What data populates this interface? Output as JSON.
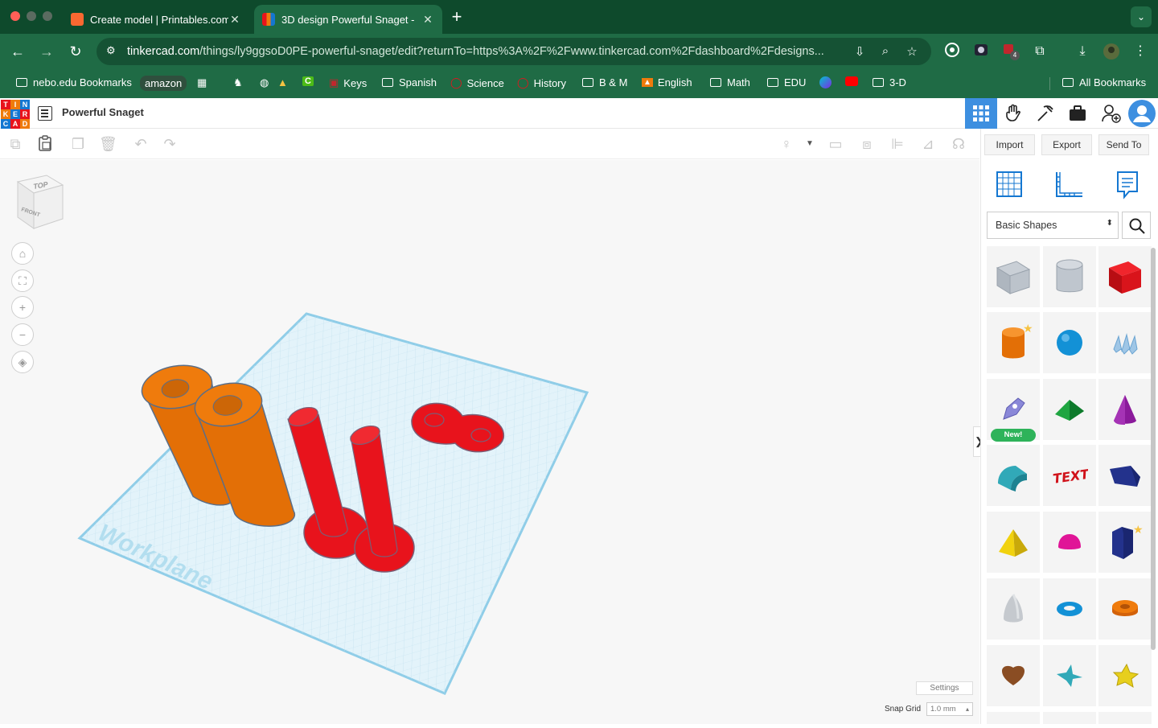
{
  "browser": {
    "tabs": [
      {
        "title": "Create model | Printables.com",
        "active": false
      },
      {
        "title": "3D design Powerful Snaget -",
        "active": true
      }
    ],
    "url_host": "tinkercad.com",
    "url_path": "/things/ly9ggsoD0PE-powerful-snaget/edit?returnTo=https%3A%2F%2Fwww.tinkercad.com%2Fdashboard%2Fdesigns...",
    "extension_badge": "4"
  },
  "bookmarks": [
    "nebo.edu Bookmarks",
    "amazon",
    "Keys",
    "Spanish",
    "Science",
    "History",
    "B & M",
    "English",
    "Math",
    "EDU",
    "3-D",
    "All Bookmarks"
  ],
  "app": {
    "logo_letters": [
      "T",
      "I",
      "N",
      "K",
      "E",
      "R",
      "C",
      "A",
      "D"
    ],
    "design_name": "Powerful Snaget",
    "import_label": "Import",
    "export_label": "Export",
    "send_label": "Send To",
    "shape_library": "Basic Shapes",
    "new_badge": "New!",
    "viewcube_top": "TOP",
    "viewcube_front": "FRONT",
    "workplane_label": "Workplane",
    "settings_label": "Settings",
    "snap_label": "Snap Grid",
    "snap_value": "1.0 mm"
  },
  "colors": {
    "chrome_dark": "#0e4a2c",
    "chrome": "#1f6b45",
    "accent_blue": "#3d8fe0",
    "shape_orange": "#ef7b0c",
    "shape_red": "#e8131c",
    "workplane": "#dff1f8"
  }
}
